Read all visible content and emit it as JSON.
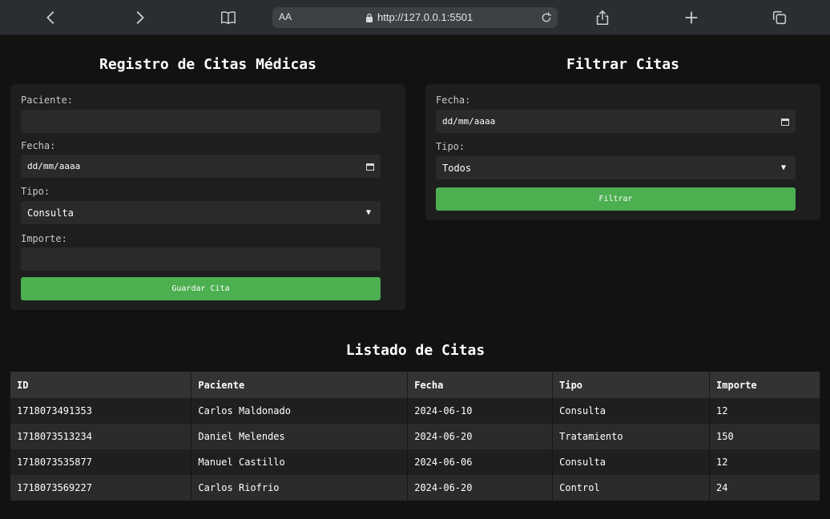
{
  "browser": {
    "text_size_label": "AA",
    "url": "http://127.0.0.1:5501"
  },
  "register": {
    "title": "Registro de Citas Médicas",
    "patient_label": "Paciente:",
    "patient_value": "",
    "date_label": "Fecha:",
    "date_value": "dd/mm/aaaa",
    "type_label": "Tipo:",
    "type_selected": "Consulta",
    "amount_label": "Importe:",
    "amount_value": "",
    "save_button": "Guardar Cita"
  },
  "filter": {
    "title": "Filtrar Citas",
    "date_label": "Fecha:",
    "date_value": "dd/mm/aaaa",
    "type_label": "Tipo:",
    "type_selected": "Todos",
    "filter_button": "Filtrar"
  },
  "listing": {
    "title": "Listado de Citas",
    "columns": [
      "ID",
      "Paciente",
      "Fecha",
      "Tipo",
      "Importe"
    ],
    "rows": [
      [
        "1718073491353",
        "Carlos Maldonado",
        "2024-06-10",
        "Consulta",
        "12"
      ],
      [
        "1718073513234",
        "Daniel Melendes",
        "2024-06-20",
        "Tratamiento",
        "150"
      ],
      [
        "1718073535877",
        "Manuel Castillo",
        "2024-06-06",
        "Consulta",
        "12"
      ],
      [
        "1718073569227",
        "Carlos Riofrio",
        "2024-06-20",
        "Control",
        "24"
      ]
    ]
  },
  "colors": {
    "background": "#121212",
    "panel": "#1e1e1e",
    "accent_button": "#4caf50"
  },
  "icons": [
    "back-icon",
    "forward-icon",
    "book-icon",
    "lock-icon",
    "reload-icon",
    "share-icon",
    "plus-icon",
    "tabs-icon",
    "calendar-icon",
    "chevron-down-icon"
  ]
}
